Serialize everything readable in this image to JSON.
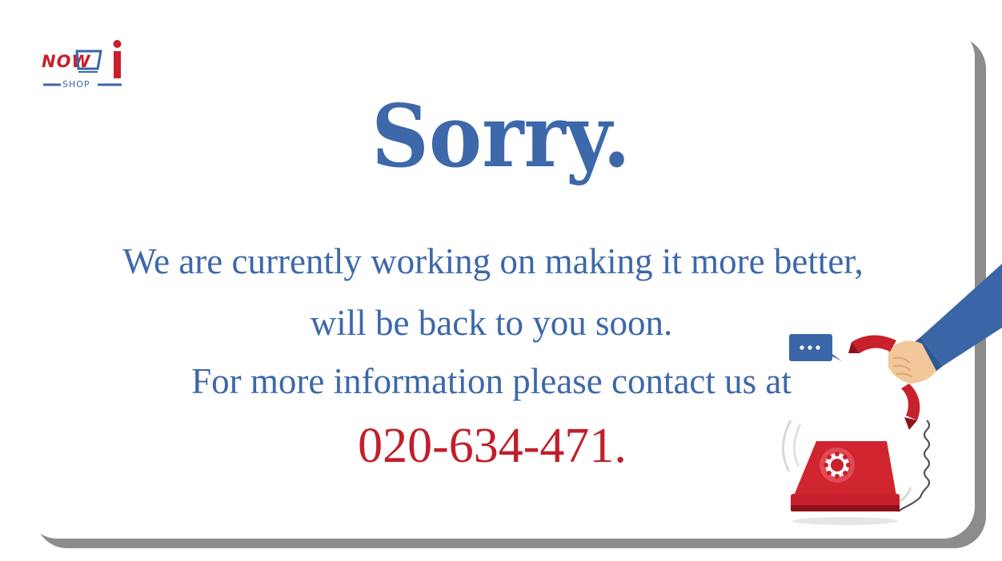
{
  "brand": {
    "now_text": "NOW",
    "i_text": "i",
    "shop_text": "SHOP"
  },
  "headline": "Sorry.",
  "message": {
    "line1": "We are currently working on making it more better,",
    "line2": "will be back to you soon.",
    "line3": "For more information please contact us at"
  },
  "phone_number": "020-634-471.",
  "colors": {
    "primary_blue": "#3d68a9",
    "accent_red": "#c11f2a",
    "card_shadow": "#8c8c8c"
  },
  "icons": {
    "logo": "nowi-shop-cart-logo",
    "chat": "speech-bubble-icon",
    "phone": "rotary-telephone-icon"
  }
}
